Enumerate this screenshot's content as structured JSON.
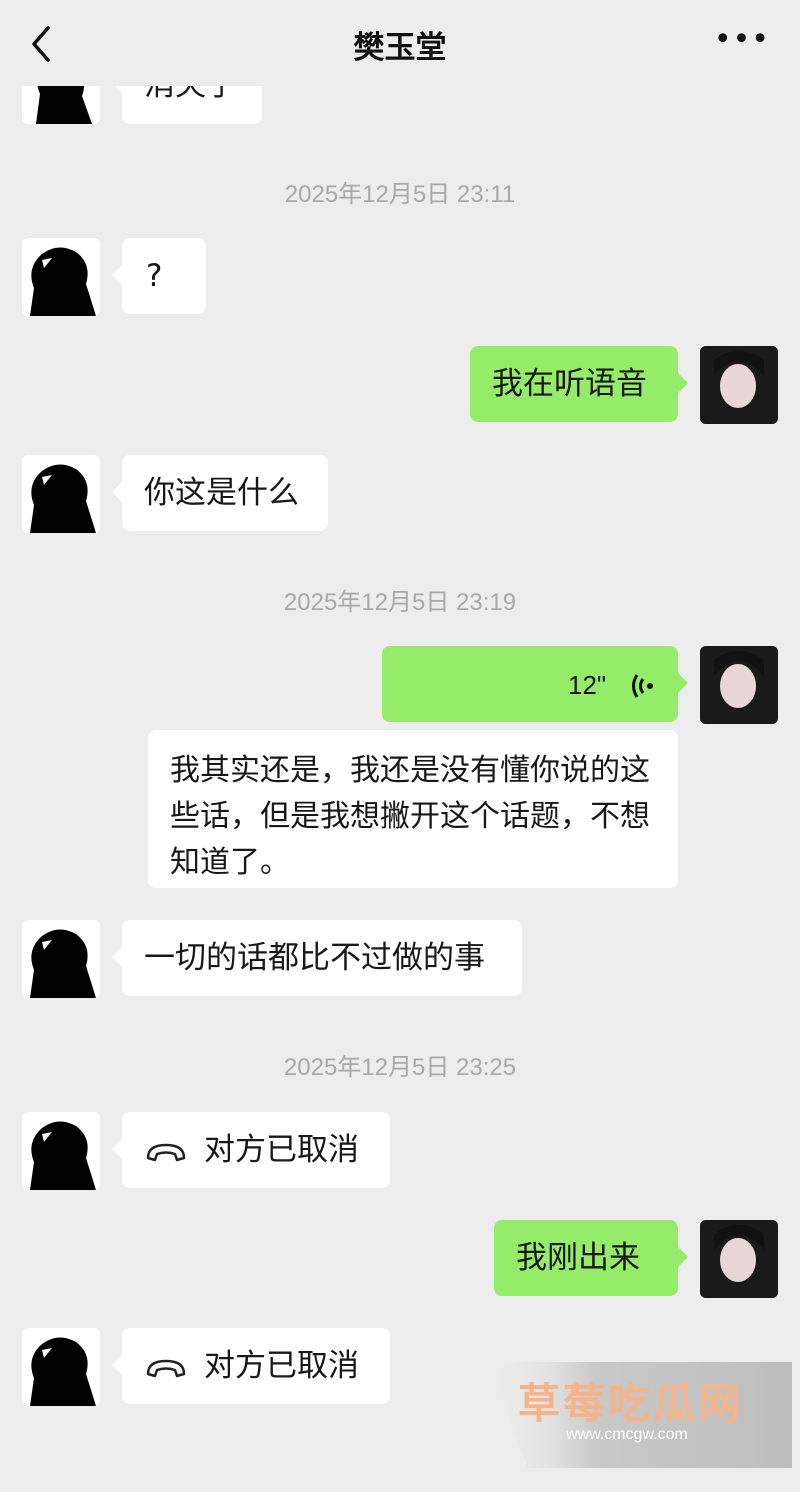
{
  "header": {
    "title": "樊玉堂",
    "back_icon": "chevron-left-icon",
    "more_icon": "more-horizontal-icon",
    "more_label": "•••"
  },
  "messages": {
    "partial_top": "消失了",
    "ts1": "2025年12月5日 23:11",
    "m1": "?",
    "m2": "我在听语音",
    "m3": "你这是什么",
    "ts2": "2025年12月5日 23:19",
    "voice_duration": "12\"",
    "voice_transcript": "我其实还是，我还是没有懂你说的这些话，但是我想撇开这个话题，不想知道了。",
    "m4": "一切的话都比不过做的事",
    "ts3": "2025年12月5日 23:25",
    "call1": "对方已取消",
    "m5": "我刚出来",
    "call2": "对方已取消"
  },
  "watermark": {
    "title": "草莓吃瓜网",
    "url": "www.cmcgw.com"
  },
  "colors": {
    "background": "#ededed",
    "outgoing_bubble": "#95ec69",
    "incoming_bubble": "#ffffff"
  }
}
